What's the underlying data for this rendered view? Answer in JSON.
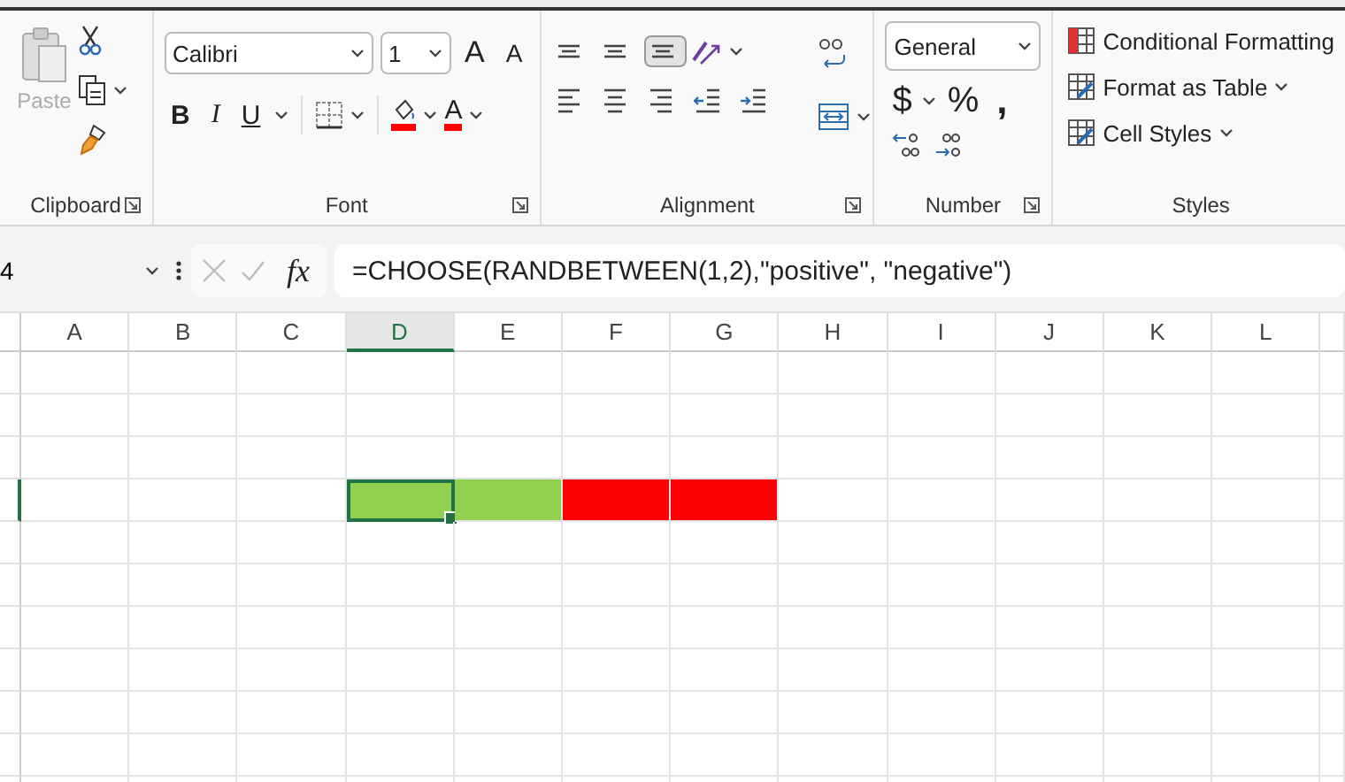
{
  "ribbon": {
    "clipboard": {
      "label": "Clipboard",
      "paste": {
        "label": "Paste",
        "disabled": true
      }
    },
    "font": {
      "label": "Font",
      "font_name": "Calibri",
      "font_size": "1",
      "grow": "A",
      "shrink": "A",
      "bold": "B",
      "italic": "I",
      "underline": "U",
      "font_color": "A"
    },
    "alignment": {
      "label": "Alignment",
      "buttons": [
        {
          "kind": "top",
          "selected": false
        },
        {
          "kind": "middle",
          "selected": false
        },
        {
          "kind": "bottom",
          "selected": true
        },
        {
          "kind": "left",
          "selected": false
        },
        {
          "kind": "center",
          "selected": false
        },
        {
          "kind": "right",
          "selected": false
        },
        {
          "kind": "outdent",
          "selected": false
        },
        {
          "kind": "indent",
          "selected": false
        }
      ]
    },
    "number": {
      "label": "Number",
      "format": "General",
      "currency": "$",
      "percent": "%",
      "comma": ","
    },
    "styles": {
      "label": "Styles",
      "items": [
        "Conditional Formatting",
        "Format as Table",
        "Cell Styles"
      ]
    }
  },
  "formula_bar": {
    "name_box": "4",
    "fx": "fx",
    "formula": "=CHOOSE(RANDBETWEEN(1,2),\"positive\", \"negative\")"
  },
  "grid": {
    "columns": [
      {
        "label": "A",
        "selected": false
      },
      {
        "label": "B",
        "selected": false
      },
      {
        "label": "C",
        "selected": false
      },
      {
        "label": "D",
        "selected": true
      },
      {
        "label": "E",
        "selected": false
      },
      {
        "label": "F",
        "selected": false
      },
      {
        "label": "G",
        "selected": false
      },
      {
        "label": "H",
        "selected": false
      },
      {
        "label": "I",
        "selected": false
      },
      {
        "label": "J",
        "selected": false
      },
      {
        "label": "K",
        "selected": false
      },
      {
        "label": "L",
        "selected": false
      }
    ],
    "rows": [
      {
        "selected": false
      },
      {
        "selected": false
      },
      {
        "selected": false
      },
      {
        "selected": true,
        "cells": [
          {
            "color": "#ffffff",
            "selected": false
          },
          {
            "color": "#ffffff",
            "selected": false
          },
          {
            "color": "#ffffff",
            "selected": false
          },
          {
            "color": "#92d050",
            "selected": true
          },
          {
            "color": "#92d050",
            "selected": false
          },
          {
            "color": "#ff0000",
            "selected": false
          },
          {
            "color": "#ff0000",
            "selected": false
          },
          {
            "color": "#ffffff",
            "selected": false
          },
          {
            "color": "#ffffff",
            "selected": false
          },
          {
            "color": "#ffffff",
            "selected": false
          },
          {
            "color": "#ffffff",
            "selected": false
          },
          {
            "color": "#ffffff",
            "selected": false
          }
        ]
      },
      {
        "selected": false
      },
      {
        "selected": false
      },
      {
        "selected": false
      },
      {
        "selected": false
      },
      {
        "selected": false
      },
      {
        "selected": false
      },
      {
        "selected": false
      }
    ]
  }
}
